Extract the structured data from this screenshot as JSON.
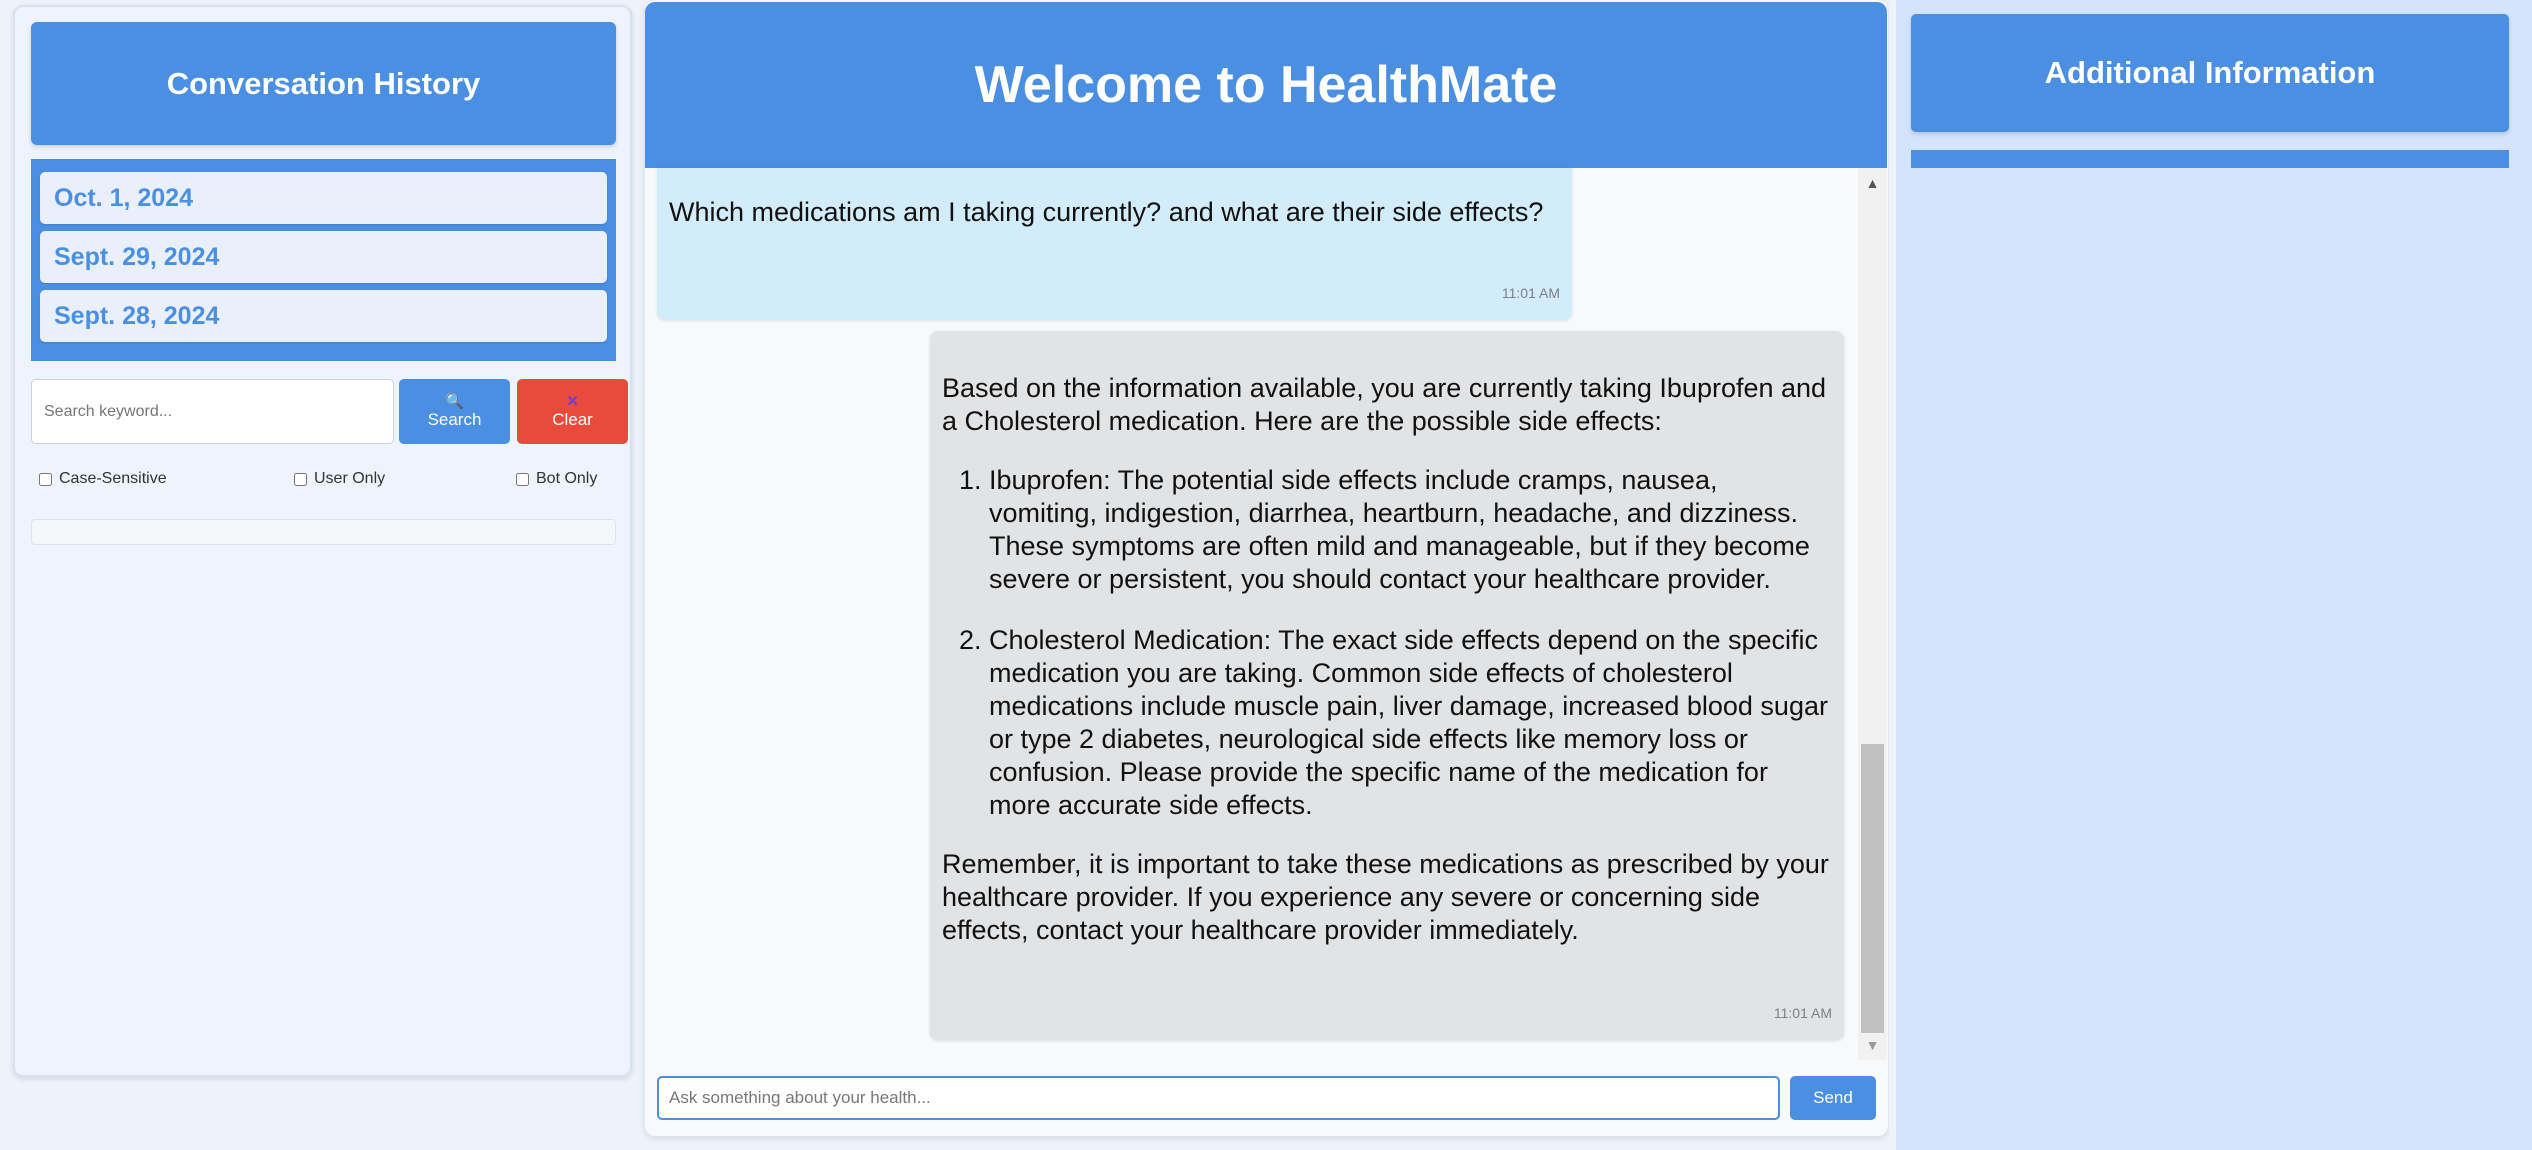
{
  "sidebar": {
    "title": "Conversation History",
    "history": [
      {
        "label": "Oct. 1, 2024"
      },
      {
        "label": "Sept. 29, 2024"
      },
      {
        "label": "Sept. 28, 2024"
      }
    ],
    "search": {
      "placeholder": "Search keyword...",
      "value": "",
      "search_label": "Search",
      "search_icon": "🔍",
      "clear_label": "Clear",
      "clear_icon": "✕"
    },
    "filters": [
      {
        "label": "Case-Sensitive",
        "checked": false
      },
      {
        "label": "User Only",
        "checked": false
      },
      {
        "label": "Bot Only",
        "checked": false
      }
    ]
  },
  "chat": {
    "header_title": "Welcome to HealthMate",
    "messages": {
      "user": {
        "text": "Which medications am I taking currently? and what are their side effects?",
        "time": "11:01 AM"
      },
      "bot": {
        "intro": "Based on the information available, you are currently taking Ibuprofen and a Cholesterol medication. Here are the possible side effects:",
        "items": [
          "Ibuprofen: The potential side effects include cramps, nausea, vomiting, indigestion, diarrhea, heartburn, headache, and dizziness. These symptoms are often mild and manageable, but if they become severe or persistent, you should contact your healthcare provider.",
          "Cholesterol Medication: The exact side effects depend on the specific medication you are taking. Common side effects of cholesterol medications include muscle pain, liver damage, increased blood sugar or type 2 diabetes, neurological side effects like memory loss or confusion. Please provide the specific name of the medication for more accurate side effects."
        ],
        "outro": "Remember, it is important to take these medications as prescribed by your healthcare provider. If you experience any severe or concerning side effects, contact your healthcare provider immediately.",
        "time": "11:01 AM"
      }
    },
    "input": {
      "placeholder": "Ask something about your health...",
      "value": ""
    },
    "send_label": "Send"
  },
  "info_panel": {
    "title": "Additional Information"
  },
  "colors": {
    "primary": "#4a8fe2",
    "danger": "#e84b3c",
    "user_bubble": "#d3ecfb",
    "bot_bubble": "#e2e3e5",
    "info_panel_bg": "#d3e4fc"
  }
}
